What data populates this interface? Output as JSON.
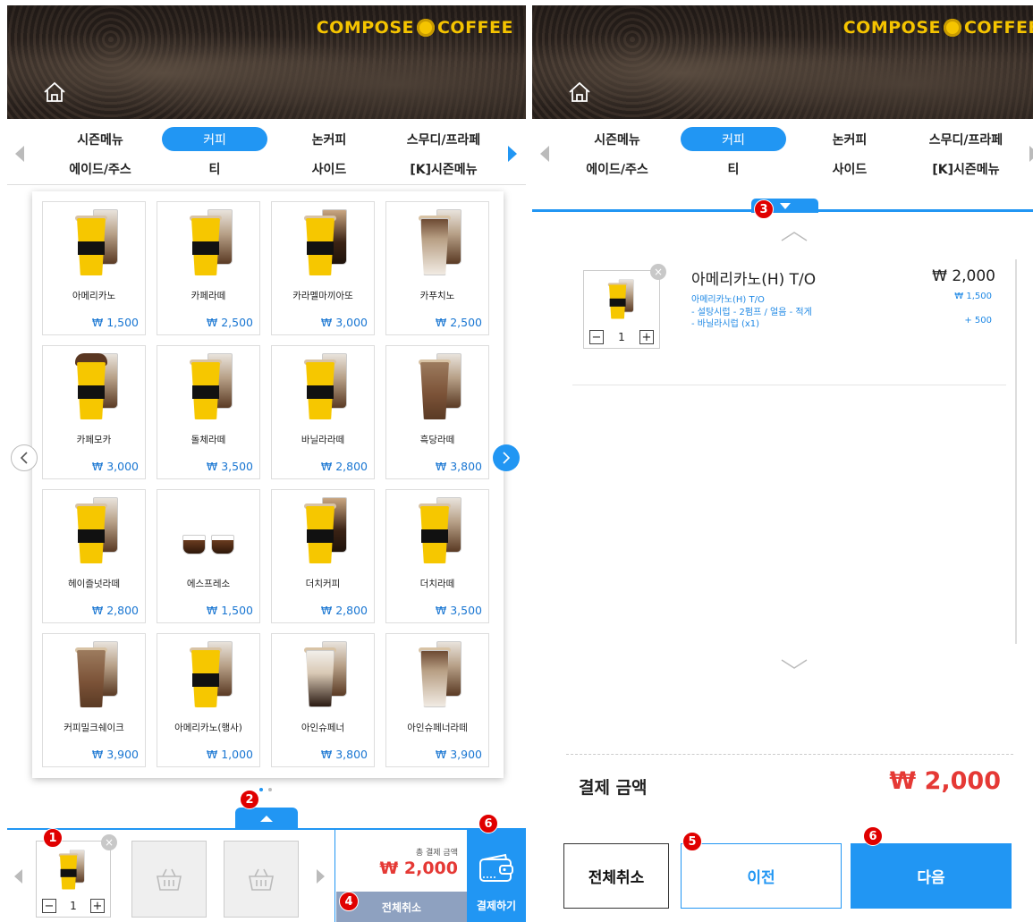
{
  "brand": "COMPOSE COFFEE",
  "categories": [
    "시즌메뉴",
    "커피",
    "논커피",
    "스무디/프라페",
    "에이드/주스",
    "티",
    "사이드",
    "[K]시즌메뉴"
  ],
  "active_category": "커피",
  "menu_items": [
    {
      "name": "아메리카노",
      "price": "₩ 1,500"
    },
    {
      "name": "카페라떼",
      "price": "₩ 2,500"
    },
    {
      "name": "카라멜마끼아또",
      "price": "₩ 3,000"
    },
    {
      "name": "카푸치노",
      "price": "₩ 2,500"
    },
    {
      "name": "카페모카",
      "price": "₩ 3,000"
    },
    {
      "name": "돌체라떼",
      "price": "₩ 3,500"
    },
    {
      "name": "바닐라라떼",
      "price": "₩ 2,800"
    },
    {
      "name": "흑당라떼",
      "price": "₩ 3,800"
    },
    {
      "name": "헤이즐넛라떼",
      "price": "₩ 2,800"
    },
    {
      "name": "에스프레소",
      "price": "₩ 1,500"
    },
    {
      "name": "더치커피",
      "price": "₩ 2,800"
    },
    {
      "name": "더치라떼",
      "price": "₩ 3,500"
    },
    {
      "name": "커피밀크쉐이크",
      "price": "₩ 3,900"
    },
    {
      "name": "아메리카노(행사)",
      "price": "₩ 1,000"
    },
    {
      "name": "아인슈페너",
      "price": "₩ 3,800"
    },
    {
      "name": "아인슈페너라떼",
      "price": "₩ 3,900"
    }
  ],
  "cart": {
    "qty": "1",
    "total_label": "총 결제 금액",
    "total": "₩ 2,000",
    "cancel_all": "전체취소",
    "pay": "결제하기"
  },
  "badges": [
    "1",
    "2",
    "3",
    "4",
    "5",
    "6"
  ],
  "order": {
    "item_name": "아메리카노(H) T/O",
    "item_price": "₩ 2,000",
    "qty": "1",
    "options": [
      {
        "label": "아메리카노(H) T/O",
        "price": "₩ 1,500"
      },
      {
        "label": "- 설탕시럽 - 2펌프 / 얼음 - 적게",
        "price": ""
      },
      {
        "label": "- 바닐라시럽 (x1)",
        "price": "+ 500"
      }
    ],
    "pay_label": "결제 금액",
    "pay_amount": "₩ 2,000",
    "btn_cancel": "전체취소",
    "btn_prev": "이전",
    "btn_next": "다음"
  },
  "colors": {
    "accent": "#2196f3",
    "price_red": "#e53935",
    "brand_yellow": "#f5c400"
  }
}
